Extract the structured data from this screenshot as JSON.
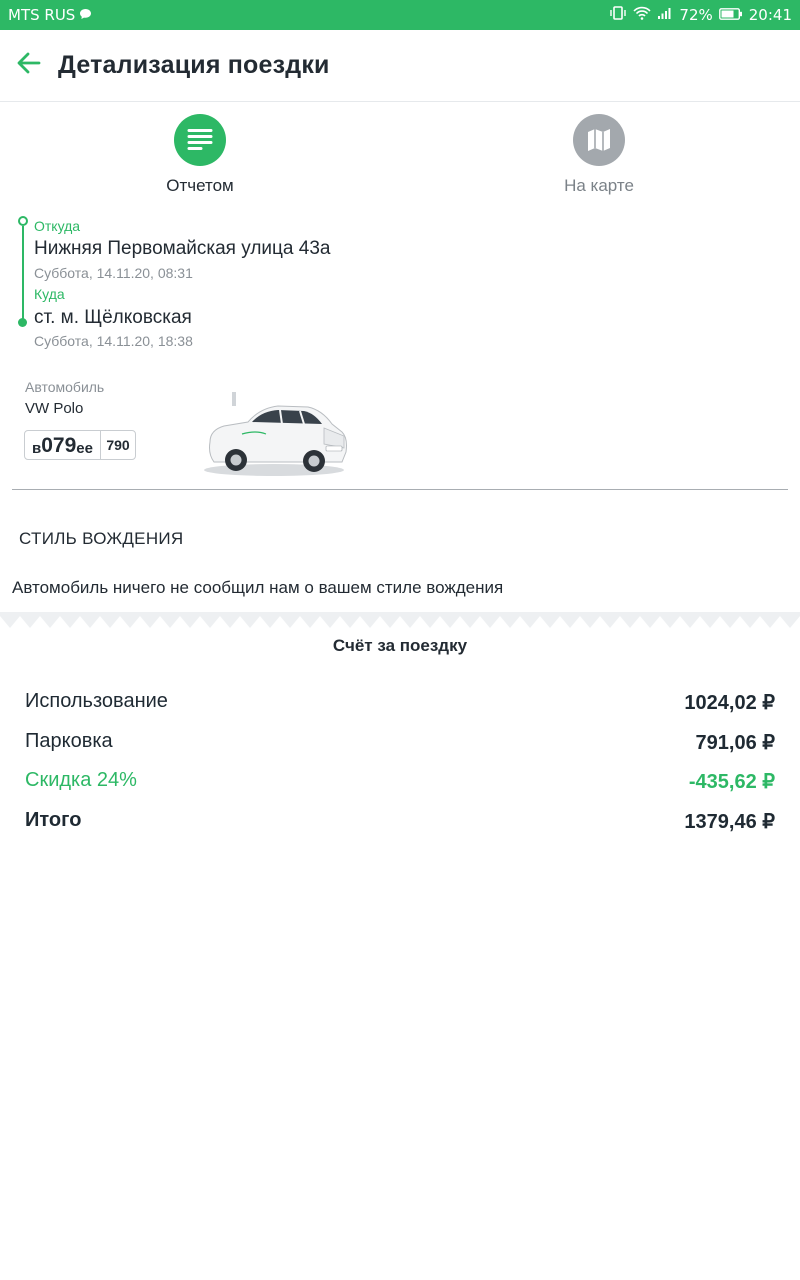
{
  "status_bar": {
    "carrier": "MTS RUS",
    "battery": "72%",
    "time": "20:41"
  },
  "header": {
    "title": "Детализация поездки",
    "back_icon": "arrow-left-icon"
  },
  "modes": {
    "report": {
      "label": "Отчетом",
      "icon": "list-icon",
      "active": true
    },
    "map": {
      "label": "На карте",
      "icon": "map-icon",
      "active": false
    }
  },
  "route": {
    "from_label": "Откуда",
    "from_address": "Нижняя Первомайская улица 43а",
    "from_time": "Суббота, 14.11.20, 08:31",
    "to_label": "Куда",
    "to_address": "ст. м. Щёлковская",
    "to_time": "Суббота, 14.11.20, 18:38"
  },
  "car": {
    "label": "Автомобиль",
    "model": "VW Polo",
    "plate_letter1": "в",
    "plate_digits": "079",
    "plate_letters2": "ее",
    "plate_region": "790"
  },
  "driving_style": {
    "title": "СТИЛЬ ВОЖДЕНИЯ",
    "text": "Автомобиль ничего не сообщил нам о вашем стиле вождения"
  },
  "bill": {
    "title": "Счёт за поездку",
    "rows": [
      {
        "name": "Использование",
        "amount": "1024,02 ₽"
      },
      {
        "name": "Парковка",
        "amount": "791,06 ₽"
      },
      {
        "name": "Скидка 24%",
        "amount": "-435,62 ₽"
      },
      {
        "name": "Итого",
        "amount": "1379,46 ₽"
      }
    ]
  },
  "colors": {
    "accent": "#2db865",
    "inactive": "#a3a8ad",
    "text": "#232b33"
  }
}
